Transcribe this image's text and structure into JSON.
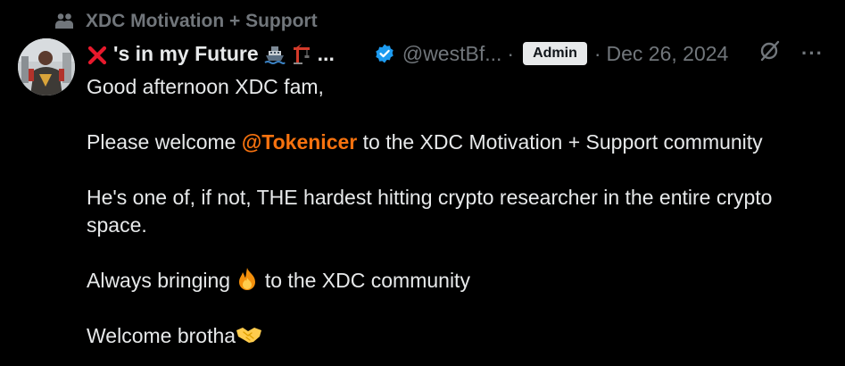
{
  "community": {
    "icon": "community-icon",
    "name": "XDC Motivation + Support"
  },
  "author": {
    "avatar_icon": "avatar",
    "name_prefix_icon": "red-x-emoji",
    "display_name": "'s in my Future",
    "name_emojis": [
      "ship-emoji",
      "crane-emoji"
    ],
    "name_ellipsis": "...",
    "verified_icon": "verified-badge-icon",
    "handle": "@westBf...",
    "role_badge": "Admin"
  },
  "meta": {
    "separator": "·",
    "date": "Dec 26, 2024",
    "grok_icon": "grok-icon",
    "more_label": "···"
  },
  "tweet": {
    "greeting": "Good afternoon XDC fam,",
    "welcome_before": "Please welcome ",
    "mention": "@Tokenicer",
    "welcome_after": " to the XDC Motivation + Support community",
    "praise": "He's one of, if not, THE hardest hitting crypto researcher in the entire crypto space.",
    "bringing_before": "Always bringing ",
    "bringing_emoji": "fire-emoji",
    "bringing_after": " to the XDC community",
    "closing": "Welcome brotha",
    "closing_emoji": "handshake-emoji"
  },
  "colors": {
    "background": "#000000",
    "text": "#e7e9ea",
    "muted": "#71767b",
    "mention": "#f6720f",
    "verified": "#1d9bf0",
    "red_x": "#e8192c"
  }
}
